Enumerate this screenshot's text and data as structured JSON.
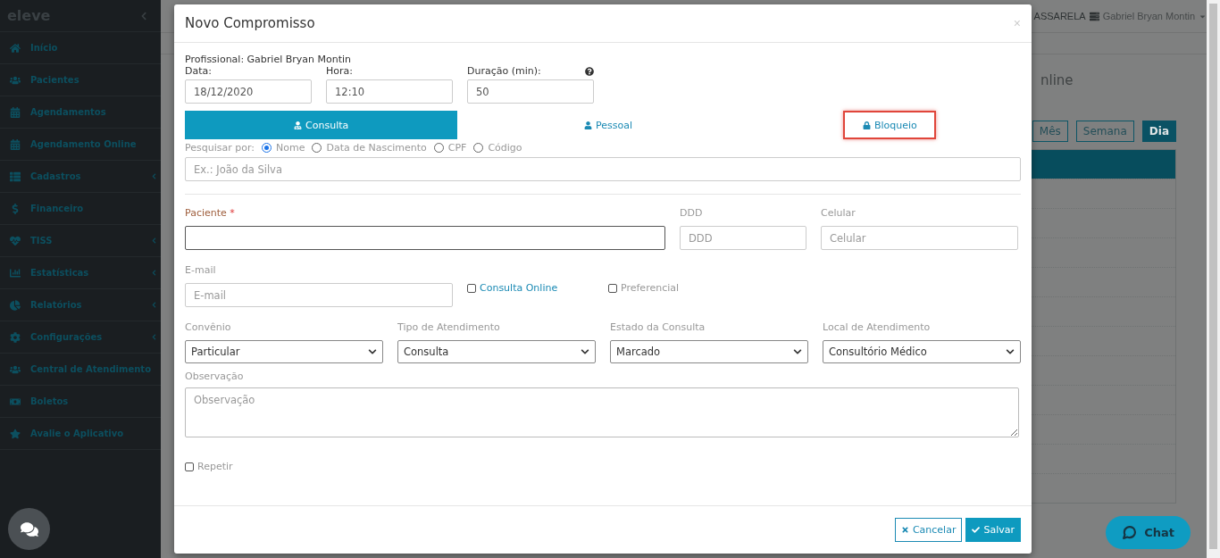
{
  "sidebar": {
    "logo": "eleve",
    "items": [
      {
        "label": "Início",
        "submenu": false
      },
      {
        "label": "Pacientes",
        "submenu": false
      },
      {
        "label": "Agendamentos",
        "submenu": false
      },
      {
        "label": "Agendamento Online",
        "submenu": false
      },
      {
        "label": "Cadastros",
        "submenu": true
      },
      {
        "label": "Financeiro",
        "submenu": false
      },
      {
        "label": "TISS",
        "submenu": true
      },
      {
        "label": "Estatísticas",
        "submenu": true
      },
      {
        "label": "Relatórios",
        "submenu": true
      },
      {
        "label": "Configurações",
        "submenu": true
      },
      {
        "label": "Central de Atendimento",
        "submenu": false
      },
      {
        "label": "Boletos",
        "submenu": false
      },
      {
        "label": "Avalie o Aplicativo",
        "submenu": false
      }
    ]
  },
  "header": {
    "clinic": "ASSARELA",
    "user": "Gabriel Bryan Montin"
  },
  "background": {
    "title": "nline",
    "views": [
      {
        "label": "Mês",
        "selected": false
      },
      {
        "label": "Semana",
        "selected": false
      },
      {
        "label": "Dia",
        "selected": true
      }
    ]
  },
  "chat_button": {
    "label": "Chat"
  },
  "modal": {
    "title": "Novo Compromisso",
    "close": "×",
    "professional": "Profissional: Gabriel Bryan Montin",
    "top_fields": [
      {
        "label": "Data:",
        "value": "18/12/2020",
        "help": false
      },
      {
        "label": "Hora:",
        "value": "12:10",
        "help": false
      },
      {
        "label": "Duração (min):",
        "value": "50",
        "help": true
      }
    ],
    "tabs": [
      {
        "label": "Consulta",
        "selected": true,
        "highlighted": false
      },
      {
        "label": "Pessoal",
        "selected": false,
        "highlighted": false
      },
      {
        "label": "Bloqueio",
        "selected": false,
        "highlighted": true
      }
    ],
    "search_by": {
      "label": "Pesquisar por:",
      "options": [
        {
          "label": "Nome",
          "selected": true
        },
        {
          "label": "Data de Nascimento",
          "selected": false
        },
        {
          "label": "CPF",
          "selected": false
        },
        {
          "label": "Código",
          "selected": false
        }
      ],
      "placeholder": "Ex.: João da Silva"
    },
    "patient": {
      "label": "Paciente",
      "required_mark": "*"
    },
    "ddd": {
      "label": "DDD",
      "placeholder": "DDD"
    },
    "cellphone": {
      "label": "Celular",
      "placeholder": "Celular"
    },
    "email": {
      "label": "E-mail",
      "placeholder": "E-mail"
    },
    "checkboxes": [
      {
        "label": "Consulta Online",
        "checked": false
      },
      {
        "label": "Preferencial",
        "checked": false
      }
    ],
    "selects": [
      {
        "label": "Convênio",
        "value": "Particular"
      },
      {
        "label": "Tipo de Atendimento",
        "value": "Consulta"
      },
      {
        "label": "Estado da Consulta",
        "value": "Marcado"
      },
      {
        "label": "Local de Atendimento",
        "value": "Consultório Médico"
      }
    ],
    "notes": {
      "label": "Observação",
      "placeholder": "Observação"
    },
    "repeat": {
      "label": "Repetir",
      "checked": false
    },
    "buttons": [
      {
        "label": "Cancelar",
        "kind": "secondary"
      },
      {
        "label": "Salvar",
        "kind": "primary"
      }
    ]
  }
}
